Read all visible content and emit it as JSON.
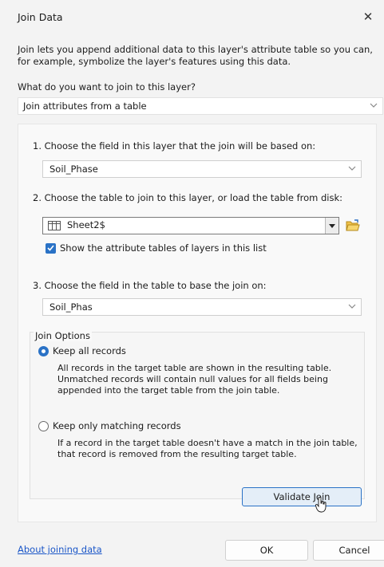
{
  "window": {
    "title": "Join Data",
    "close_glyph": "✕"
  },
  "intro": "Join lets you append additional data to this layer's attribute table so you can, for example, symbolize the layer's features using this data.",
  "question": "What do you want to join to this layer?",
  "join_type": {
    "selected": "Join attributes from a table"
  },
  "steps": {
    "step1_label": "1.  Choose the field in this layer that the join will be based on:",
    "step1_value": "Soil_Phase",
    "step2_label": "2.  Choose the table to join to this layer, or load the table from disk:",
    "step2_value": "Sheet2$",
    "step2_checkbox_label": "Show the attribute tables of layers in this list",
    "step2_checkbox_checked": true,
    "step3_label": "3.  Choose the field in the table to base the join on:",
    "step3_value": "Soil_Phas"
  },
  "join_options": {
    "legend": "Join Options",
    "keep_all_label": "Keep all records",
    "keep_all_selected": true,
    "keep_all_desc": "All records in the target table are shown in the resulting table. Unmatched records will contain null values for all fields being appended into the target table from the join table.",
    "keep_matching_label": "Keep only matching records",
    "keep_matching_selected": false,
    "keep_matching_desc": "If a record in the target table doesn't have a match in the join table, that record is removed from the resulting target table."
  },
  "validate_label": "Validate Join",
  "about_link": "About joining data",
  "ok_label": "OK",
  "cancel_label": "Cancel",
  "colors": {
    "accent": "#2a72c6",
    "link": "#1a56c8",
    "background": "#f3f3f3"
  },
  "icons": [
    "close-icon",
    "chevron-down-icon",
    "table-icon",
    "folder-open-icon",
    "checkmark-icon",
    "mouse-cursor-icon"
  ]
}
